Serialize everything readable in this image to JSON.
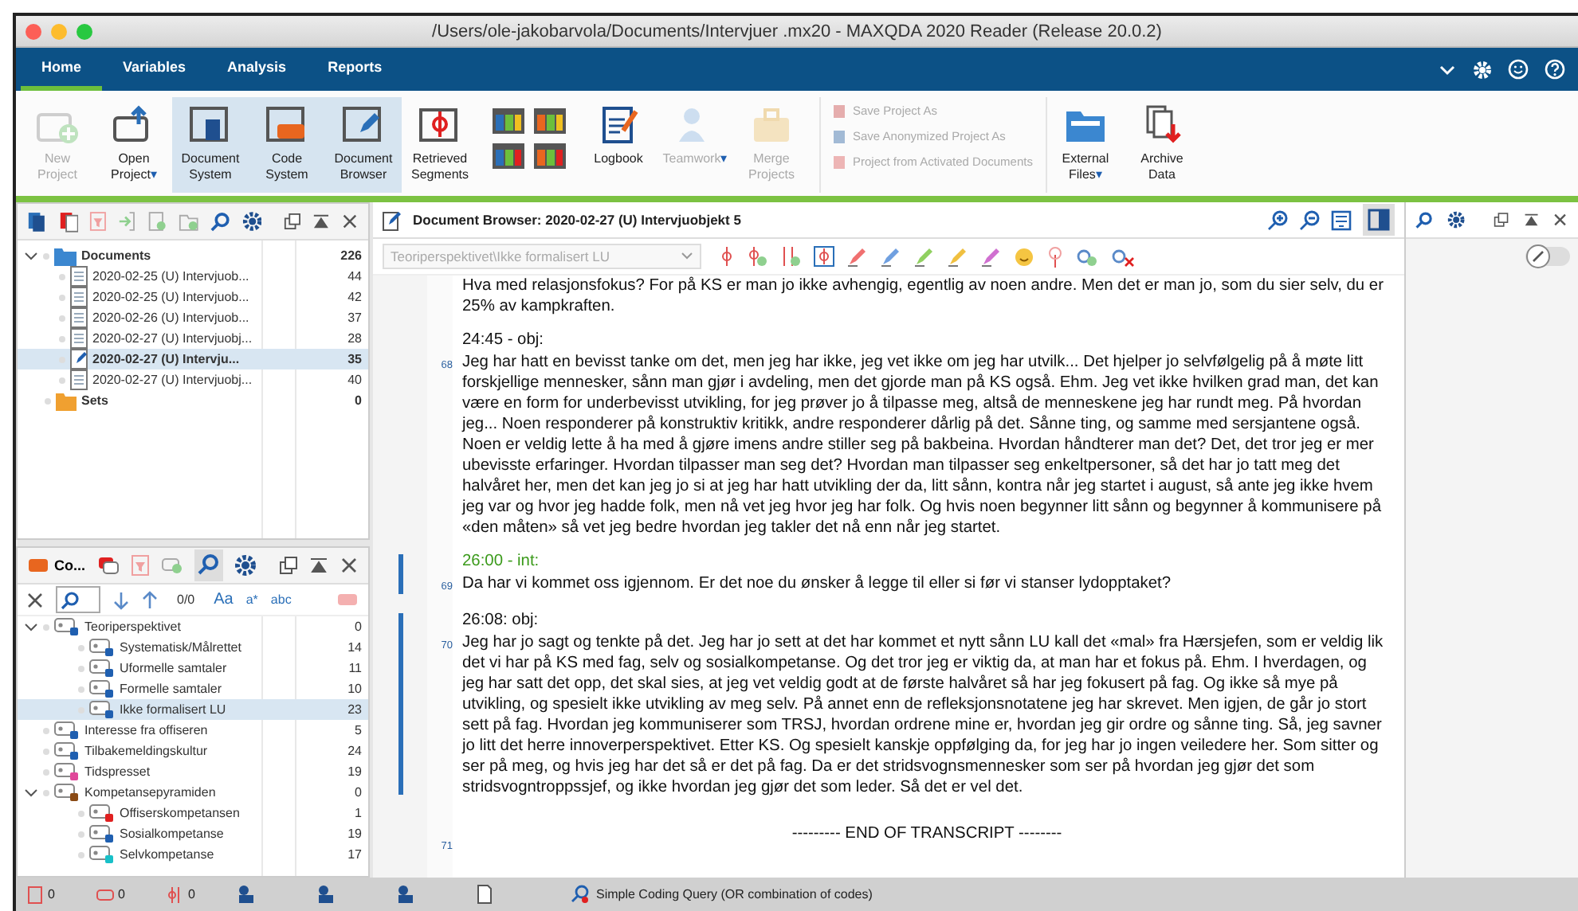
{
  "window": {
    "title": "/Users/ole-jakobarvola/Documents/Intervjuer .mx20 - MAXQDA 2020 Reader (Release 20.0.2)"
  },
  "tabs": [
    {
      "label": "Home",
      "selected": true
    },
    {
      "label": "Variables",
      "selected": false
    },
    {
      "label": "Analysis",
      "selected": false
    },
    {
      "label": "Reports",
      "selected": false
    }
  ],
  "ribbon": [
    {
      "kind": "large",
      "label": "New Project",
      "disabled": true,
      "selected": false
    },
    {
      "kind": "large",
      "label": "Open Project",
      "caret": "▾",
      "disabled": false,
      "selected": false
    },
    {
      "kind": "large",
      "label": "Document System",
      "disabled": false,
      "selected": true
    },
    {
      "kind": "large",
      "label": "Code System",
      "disabled": false,
      "selected": true
    },
    {
      "kind": "large",
      "label": "Document Browser",
      "disabled": false,
      "selected": true
    },
    {
      "kind": "large",
      "label": "Retrieved Segments",
      "disabled": false,
      "selected": false
    },
    {
      "kind": "grid"
    },
    {
      "kind": "large",
      "label": "Logbook",
      "disabled": false,
      "selected": false
    },
    {
      "kind": "large",
      "label": "Teamwork",
      "caret": "▾",
      "disabled": true,
      "selected": false
    },
    {
      "kind": "large",
      "label": "Merge Projects",
      "disabled": true,
      "selected": false
    },
    {
      "kind": "small",
      "items": [
        {
          "label": "Save Project As",
          "disabled": true
        },
        {
          "label": "Save Anonymized Project As",
          "disabled": true
        },
        {
          "label": "Project from Activated Documents",
          "disabled": true
        }
      ]
    },
    {
      "kind": "large",
      "label": "External Files",
      "caret": "▾",
      "disabled": false,
      "selected": false
    },
    {
      "kind": "large",
      "label": "Archive Data",
      "disabled": false,
      "selected": false
    }
  ],
  "document_system": {
    "root": {
      "label": "Documents",
      "count": "226",
      "expanded": true,
      "children": [
        {
          "label": "2020-02-25 (U) Intervjuob...",
          "count": "44",
          "selected": false,
          "editing": false
        },
        {
          "label": "2020-02-25 (U) Intervjuob...",
          "count": "42",
          "selected": false,
          "editing": false
        },
        {
          "label": "2020-02-26 (U) Intervjuob...",
          "count": "37",
          "selected": false,
          "editing": false
        },
        {
          "label": "2020-02-27 (U) Intervjuobj...",
          "count": "28",
          "selected": false,
          "editing": false
        },
        {
          "label": "2020-02-27 (U) Intervju...",
          "count": "35",
          "selected": true,
          "editing": true
        },
        {
          "label": "2020-02-27 (U) Intervjuobj...",
          "count": "40",
          "selected": false,
          "editing": false
        }
      ]
    },
    "sets": {
      "label": "Sets",
      "count": "0"
    }
  },
  "code_system": {
    "title": "Co...",
    "search": {
      "counter": "0/0",
      "case_label": "Aa",
      "wildcard_label": "a*",
      "word_label": "abc"
    },
    "codes": [
      {
        "label": "Teoriperspektivet",
        "count": "0",
        "color": "#1f5fb0",
        "expanded": true,
        "selected": false,
        "children": [
          {
            "label": "Systematisk/Målrettet",
            "count": "14",
            "color": "#1f5fb0",
            "selected": false
          },
          {
            "label": "Uformelle samtaler",
            "count": "11",
            "color": "#1f5fb0",
            "selected": false
          },
          {
            "label": "Formelle samtaler",
            "count": "10",
            "color": "#1f5fb0",
            "selected": false
          },
          {
            "label": "Ikke formalisert LU",
            "count": "23",
            "color": "#1f5fb0",
            "selected": true
          }
        ]
      },
      {
        "label": "Interesse fra offiseren",
        "count": "5",
        "color": "#1f5fb0",
        "selected": false
      },
      {
        "label": "Tilbakemeldingskultur",
        "count": "24",
        "color": "#1f5fb0",
        "selected": false
      },
      {
        "label": "Tidspresset",
        "count": "19",
        "color": "#e0479a",
        "selected": false
      },
      {
        "label": "Kompetansepyramiden",
        "count": "0",
        "color": "#8a4a14",
        "expanded": true,
        "selected": false,
        "children": [
          {
            "label": "Offiserskompetansen",
            "count": "1",
            "color": "#e02020",
            "selected": false
          },
          {
            "label": "Sosialkompetanse",
            "count": "19",
            "color": "#1f5fb0",
            "selected": false
          },
          {
            "label": "Selvkompetanse",
            "count": "17",
            "color": "#18c0c8",
            "selected": false
          }
        ]
      }
    ]
  },
  "document_browser": {
    "side_toggle": {
      "on": false
    },
    "title": "Document Browser: 2020-02-27 (U) Intervjuobjekt 5",
    "code_dropdown": {
      "placeholder": "Teoriperspektivet\\Ikke formalisert LU"
    },
    "paragraphs": [
      {
        "coded": false,
        "text": "Hva med relasjonsfokus? For på KS er man jo ikke avhengig, egentlig av noen andre. Men det er man jo, som du sier selv, du er 25% av kampkraften."
      },
      {
        "number": "68",
        "coded": false,
        "heading": "24:45 - obj:",
        "interviewer": false,
        "text": "Jeg har hatt en bevisst tanke om det, men jeg har ikke, jeg vet ikke om jeg har utvilk... Det hjelper jo selvfølgelig på å møte litt forskjellige mennesker, sånn man gjør i avdeling, men det gjorde man på KS også. Ehm. Jeg vet ikke hvilken grad man, det kan være en form for underbevisst utvikling, for jeg prøver jo å tilpasse meg, altså de menneskene jeg har rundt meg. På hvordan jeg... Noen responderer på konstruktiv kritikk, andre responderer dårlig på det. Sånne ting, og samme med sersjantene også. Noen er veldig lette å ha med å gjøre imens andre stiller seg på bakbeina. Hvordan håndterer man det? Det, det tror jeg er mer ubevisste erfaringer. Hvordan tilpasser man seg det? Hvordan man tilpasser seg enkeltpersoner, så det har jo tatt meg det halvåret her, men det kan jeg jo si at jeg har hatt utvikling der da, litt sånn, kontra når jeg startet i august, så ante jeg ikke hvem jeg var og hvor jeg hadde folk, men nå vet jeg hvor jeg har folk. Og hvis noen begynner litt sånn og begynner å kommunisere på «den måten» så vet jeg bedre hvordan jeg takler det nå enn når jeg startet."
      },
      {
        "number": "69",
        "coded": true,
        "heading": "26:00 - int:",
        "interviewer": true,
        "text": "Da har vi kommet oss igjennom. Er det noe du ønsker å legge til eller si før vi stanser lydopptaket?"
      },
      {
        "number": "70",
        "coded": true,
        "heading": "26:08: obj:",
        "interviewer": false,
        "text": "Jeg har jo sagt og tenkte på det. Jeg har jo sett at det har kommet et nytt sånn LU kall det «mal» fra Hærsjefen, som er veldig lik det vi har på KS med fag, selv og sosialkompetanse. Og det tror jeg er viktig da, at man har et fokus på. Ehm. I hverdagen, og jeg har satt det opp, det skal sies, at jeg vet veldig godt at de første halvåret så har jeg fokusert på fag. Og ikke så mye på utvikling, og spesielt ikke utvikling av meg selv. På annet enn de refleksjonsnotatene jeg har skrevet. Men igjen, de går jo stort sett på fag. Hvordan jeg kommuniserer som TRSJ, hvordan ordrene mine er, hvordan jeg gir ordre og sånne ting. Så, jeg savner jo litt det herre innoverperspektivet. Etter KS. Og spesielt kanskje oppfølging da, for jeg har jo ingen veiledere her. Som sitter og ser på meg, og hvis jeg har det så er det på fag. Da er det stridsvognsmennesker som ser på hvordan jeg gjør det som stridsvogntroppssjef, og ikke hvordan jeg gjør det som leder. Så det er vel det."
      },
      {
        "number": "71",
        "coded": false,
        "text": "--------- END OF TRANSCRIPT --------",
        "centered": true
      }
    ]
  },
  "status_bar": {
    "counts": [
      "0",
      "0",
      "0"
    ],
    "query": "Simple Coding Query (OR combination of codes)"
  }
}
